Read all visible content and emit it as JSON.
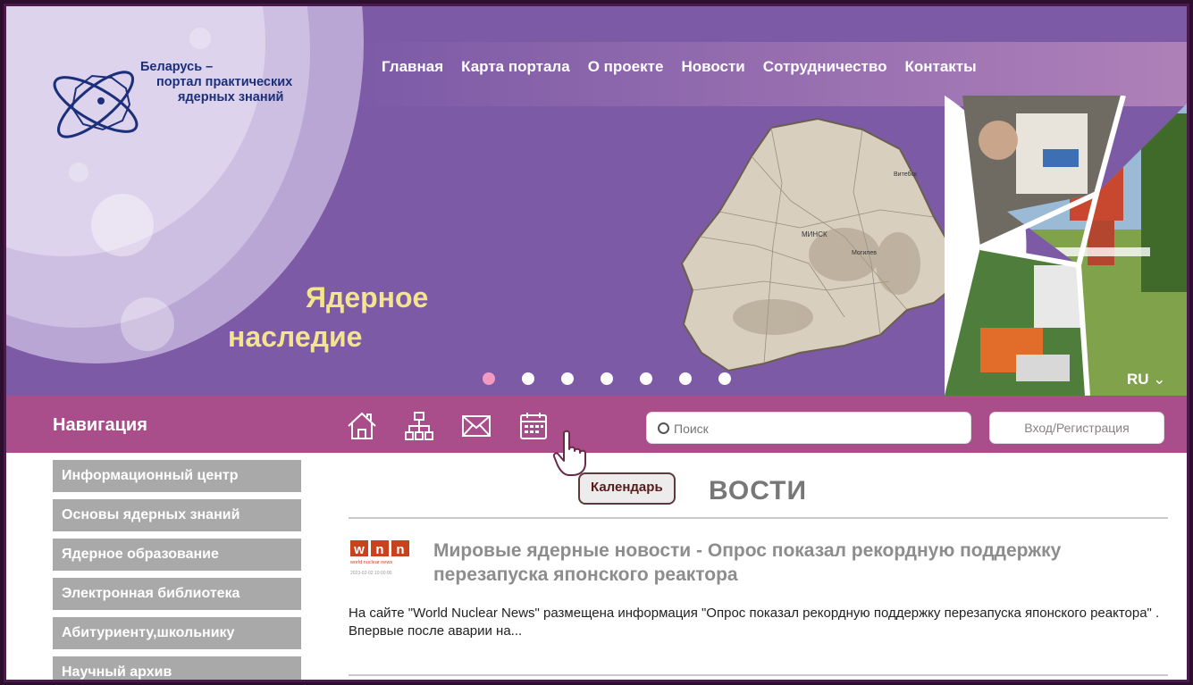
{
  "logo": {
    "line1": "Беларусь –",
    "line2": "портал практических",
    "line3": "ядерных знаний"
  },
  "topnav": [
    "Главная",
    "Карта портала",
    "О проекте",
    "Новости",
    "Сотрудничество",
    "Контакты"
  ],
  "banner": {
    "slogan_line1": "Ядерное",
    "slogan_line2": "наследие",
    "slide_count": 7,
    "active_slide": 1,
    "language": "RU"
  },
  "navbar": {
    "title": "Навигация",
    "icons": [
      "home-icon",
      "sitemap-icon",
      "mail-icon",
      "calendar-icon"
    ],
    "search_placeholder": "Поиск",
    "login_label": "Вход/Регистрация"
  },
  "tooltip": "Календарь",
  "sidebar": {
    "items": [
      "Информационный центр",
      "Основы ядерных знаний",
      "Ядерное образование",
      "Электронная библиотека",
      "Абитуриенту,школьнику",
      "Научный архив"
    ]
  },
  "news": {
    "section_visible_text": "ВОСТИ",
    "items": [
      {
        "source_logo": "wnn",
        "source_caption": "world nuclear news",
        "date": "2023-02-02 10:00:00",
        "title": "Мировые ядерные новости - Опрос показал рекордную поддержку перезапуска японского реактора",
        "excerpt": "На сайте \"World Nuclear News\" размещена информация \"Опрос показал рекордную поддержку перезапуска японского реактора\" . Впервые после аварии на..."
      }
    ]
  },
  "colors": {
    "banner_purple": "#7c5aa6",
    "navbar_magenta": "#a94e8a",
    "sidebar_gray": "#a9a9a9",
    "slogan_yellow": "#f4e58c",
    "active_dot": "#f29ac4",
    "logo_blue": "#1b2f7a"
  }
}
